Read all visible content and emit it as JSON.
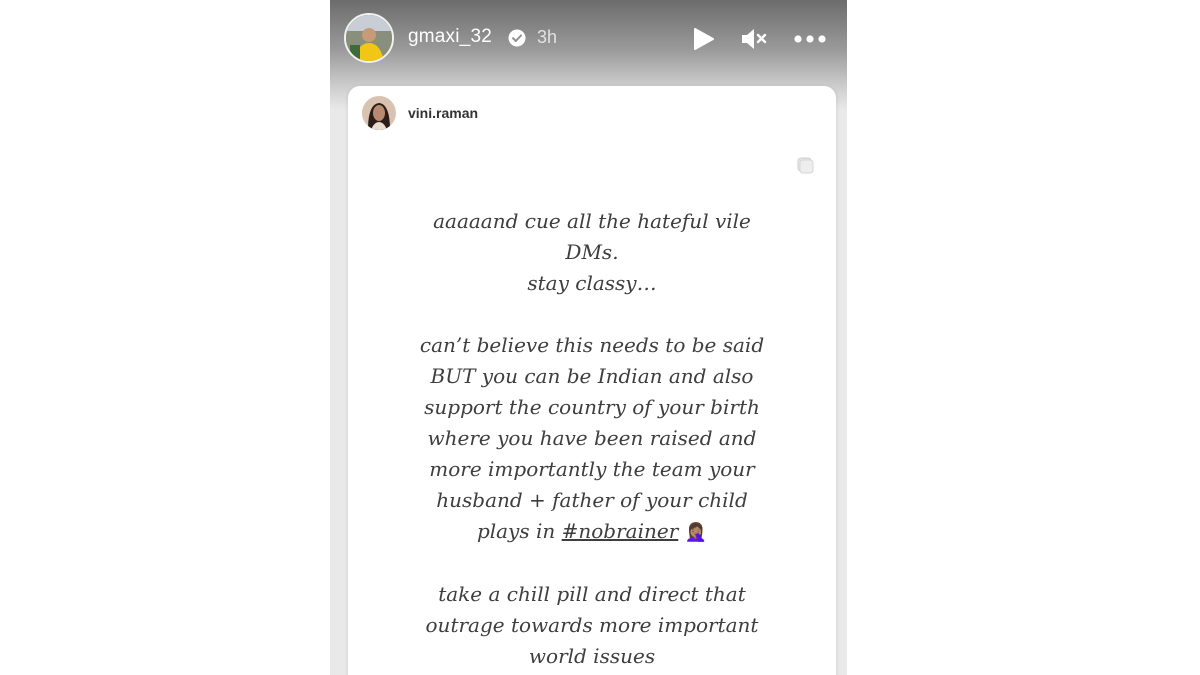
{
  "story": {
    "username": "gmaxi_32",
    "time": "3h",
    "icons": {
      "verified": "verified-badge-icon",
      "play": "play-icon",
      "mute": "mute-icon",
      "more": "more-options-icon"
    },
    "repost": {
      "username": "vini.raman",
      "icon": "sticker-icon"
    },
    "text": {
      "p1_l1": "aaaaand cue all the hateful vile",
      "p1_l2": "DMs.",
      "p1_l3": "stay classy…",
      "p2_l1": "can’t believe this needs to be said",
      "p2_l2": "BUT you can be Indian and also",
      "p2_l3": "support the country of your birth",
      "p2_l4": "where you have been raised and",
      "p2_l5": "more importantly the team your",
      "p2_l6": "husband + father of your child",
      "p2_l7": "plays in",
      "hashtag": "#nobrainer",
      "emoji": "🤦🏽‍♀️",
      "p3_l1": "take a chill pill and direct that",
      "p3_l2": "outrage towards more important",
      "p3_l3": "world issues"
    }
  }
}
